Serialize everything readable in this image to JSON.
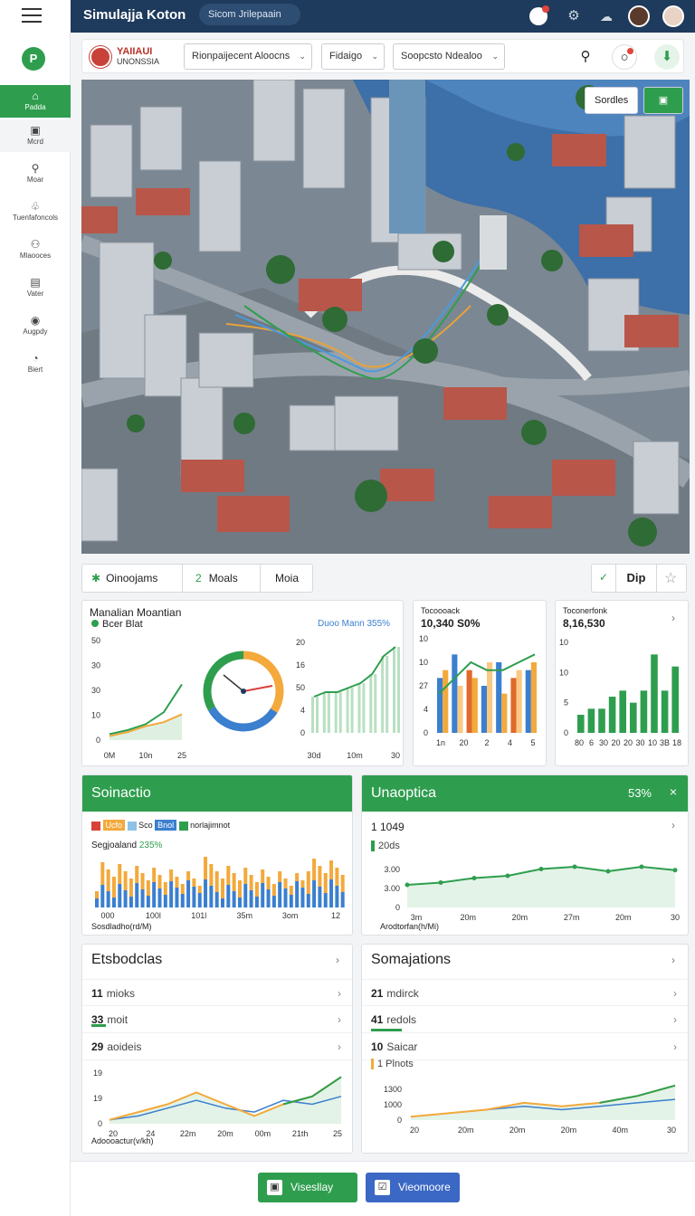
{
  "app": {
    "title": "Simulajja Koton",
    "search_placeholder": "Sicom Jrilepaain"
  },
  "sidebar": {
    "logo": "P",
    "items": [
      {
        "label": "Padda",
        "icon": "⌂"
      },
      {
        "label": "Mcrd",
        "icon": "▣"
      },
      {
        "label": "Moar",
        "icon": "⚲"
      },
      {
        "label": "Tuenfafoncols",
        "icon": "♧"
      },
      {
        "label": "Mlaooces",
        "icon": "⚇"
      },
      {
        "label": "Vater",
        "icon": "▤"
      },
      {
        "label": "Augpdy",
        "icon": "◉"
      },
      {
        "label": "Biert",
        "icon": "◔"
      }
    ]
  },
  "toolbar": {
    "brand_title": "YAIIAUI",
    "brand_sub": "UNONSSIA",
    "dropdowns": [
      "Rionpaijecent Aloocns",
      "Fidaigo",
      "Soopcsto Ndealoo"
    ]
  },
  "map": {
    "btn_label": "Sordles"
  },
  "tabs": {
    "items": [
      {
        "icon": "✱",
        "label": "Oinoojams"
      },
      {
        "num": "2",
        "label": "Moals"
      },
      {
        "label": "Moia"
      }
    ],
    "dip_label": "Dip"
  },
  "cards": {
    "c1": {
      "title": "Manalian Moantian",
      "legend": "Bcer Blat",
      "right_label": "Duoo Mann 355%"
    },
    "c2": {
      "title": "Tocoooack",
      "value": "10,340 S0%"
    },
    "c3": {
      "title": "Toconerfonk",
      "value": "8,16,530"
    },
    "c4": {
      "title": "Soinactio",
      "legend": [
        "Ucfo",
        "Sco",
        "Bnol",
        "norlajimnot"
      ],
      "subtitle": "Segjoaland",
      "subtitle_pct": "235%",
      "xlabel": "Sosdladho(rd/M)"
    },
    "c5": {
      "title": "Unaoptica",
      "pct": "53%",
      "value": "1 1049",
      "legend": "20ds",
      "xlabel": "Arodtorfan(h/Mi)"
    },
    "c6": {
      "title": "Etsbodclas",
      "rows": [
        {
          "num": "11",
          "label": "mioks"
        },
        {
          "num": "33",
          "label": "moit"
        },
        {
          "num": "29",
          "label": "aoideis"
        }
      ],
      "xlabel": "Adoooactur(v/kh)"
    },
    "c7": {
      "title": "Somajations",
      "rows": [
        {
          "num": "21",
          "label": "mdirck"
        },
        {
          "num": "41",
          "label": "redols"
        },
        {
          "num": "10",
          "label": "Saicar"
        }
      ],
      "legend": "1 Plnots"
    }
  },
  "chart_data": [
    {
      "type": "line",
      "ylim": [
        0,
        50
      ],
      "ytick_labels": [
        "50",
        "30",
        "30",
        "10",
        "0"
      ],
      "xtick_labels": [
        "0M",
        "10n",
        "25"
      ],
      "series": [
        {
          "name": "",
          "values": [
            3,
            5,
            8,
            14,
            28
          ]
        },
        {
          "name": "",
          "values": [
            2,
            4,
            7,
            9,
            13
          ]
        }
      ]
    },
    {
      "type": "pie",
      "values": [
        34,
        33,
        33
      ],
      "colors": [
        "#f3a93b",
        "#3b7fcf",
        "#2e9e4e"
      ]
    },
    {
      "type": "area",
      "ylim": [
        0,
        20
      ],
      "ytick_labels": [
        "20",
        "16",
        "50",
        "4",
        "0"
      ],
      "xtick_labels": [
        "30d",
        "10m",
        "30"
      ],
      "values": [
        8,
        9,
        9,
        10,
        11,
        13,
        17,
        19
      ]
    },
    {
      "type": "bar",
      "ylim": [
        0,
        12
      ],
      "ytick_labels": [
        "10",
        "10",
        "27",
        "4",
        "0"
      ],
      "xtick_labels": [
        "1n",
        "20",
        "2",
        "4",
        "5"
      ],
      "series": [
        {
          "name": "",
          "values": [
            7,
            10,
            8,
            6,
            9,
            7,
            8
          ]
        },
        {
          "name": "",
          "values": [
            8,
            6,
            7,
            9,
            5,
            8,
            9
          ]
        }
      ],
      "line": [
        5,
        7,
        9,
        8,
        8,
        9,
        10
      ]
    },
    {
      "type": "bar",
      "ylim": [
        0,
        15
      ],
      "ytick_labels": [
        "10",
        "10",
        "5",
        "0"
      ],
      "xtick_labels": [
        "80",
        "6",
        "30",
        "20",
        "20",
        "30",
        "10",
        "3B",
        "18"
      ],
      "values": [
        3,
        4,
        4,
        6,
        7,
        5,
        7,
        13,
        7,
        11
      ]
    },
    {
      "type": "bar",
      "xtick_labels": [
        "000",
        "100l",
        "101l",
        "35m",
        "3om",
        "12"
      ],
      "series": [
        {
          "name": "Ucfo",
          "values": []
        },
        {
          "name": "Sco",
          "values": []
        }
      ]
    },
    {
      "type": "line",
      "ytick_labels": [
        "3.00",
        "3.00",
        "0"
      ],
      "xtick_labels": [
        "3m",
        "20m",
        "20m",
        "27m",
        "20m",
        "30"
      ],
      "values": [
        2,
        2.2,
        2.6,
        2.8,
        3.4,
        3.6,
        3.2,
        3.6,
        3.3
      ]
    },
    {
      "type": "line",
      "ytick_labels": [
        "19",
        "19",
        "0"
      ],
      "xtick_labels": [
        "20",
        "24",
        "22m",
        "20m",
        "00m",
        "21th",
        "25"
      ],
      "series": [
        {
          "name": "",
          "values": [
            1,
            2,
            4,
            6,
            4,
            3,
            6,
            5,
            7
          ]
        },
        {
          "name": "",
          "values": [
            1,
            3,
            5,
            8,
            5,
            2,
            5,
            7,
            12
          ]
        }
      ]
    },
    {
      "type": "line",
      "ytick_labels": [
        "1300",
        "1000",
        "0"
      ],
      "xtick_labels": [
        "20",
        "20m",
        "20m",
        "20m",
        "40m",
        "30"
      ],
      "series": [
        {
          "name": "",
          "values": [
            1,
            2,
            3,
            4,
            3,
            4,
            5,
            6
          ]
        },
        {
          "name": "",
          "values": [
            1,
            2,
            3,
            5,
            4,
            5,
            7,
            10
          ]
        }
      ]
    }
  ]
}
